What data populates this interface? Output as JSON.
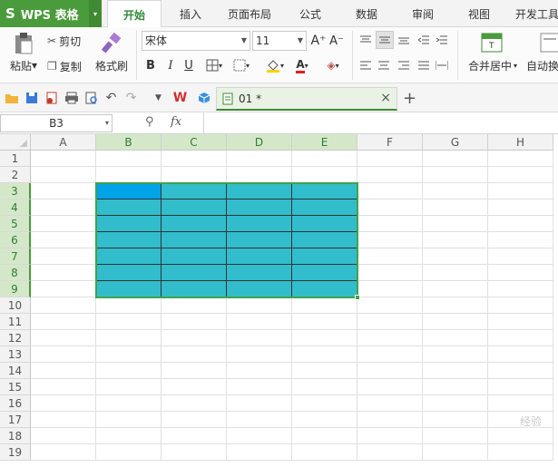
{
  "app": {
    "logo": "S",
    "name": "WPS 表格",
    "arrow": "▾"
  },
  "tabs": [
    "开始",
    "插入",
    "页面布局",
    "公式",
    "数据",
    "审阅",
    "视图",
    "开发工具"
  ],
  "active_tab": "开始",
  "ribbon": {
    "paste": "粘贴",
    "cut": "剪切",
    "copy": "复制",
    "format_painter": "格式刷",
    "font_name": "宋体",
    "font_size": "11",
    "grow": "A⁺",
    "shrink": "A⁻",
    "bold": "B",
    "italic": "I",
    "underline": "U",
    "merge_center": "合并居中",
    "auto_wrap": "自动换"
  },
  "document_tab": {
    "title": "01 *",
    "close": "×",
    "add": "+"
  },
  "formula_bar": {
    "name_box": "B3",
    "fx": "fx",
    "zoom_icon": "⚲"
  },
  "columns": [
    "A",
    "B",
    "C",
    "D",
    "E",
    "F",
    "G",
    "H"
  ],
  "rows": [
    "1",
    "2",
    "3",
    "4",
    "5",
    "6",
    "7",
    "8",
    "9",
    "10",
    "11",
    "12",
    "13",
    "14",
    "15",
    "16",
    "17",
    "18",
    "19"
  ],
  "selection": {
    "range": "B3:E9",
    "active_cell": "B3",
    "fill_color": "#31bdcc",
    "active_color": "#00a2e8",
    "accent": "#3fa34d"
  },
  "watermark": "经验"
}
